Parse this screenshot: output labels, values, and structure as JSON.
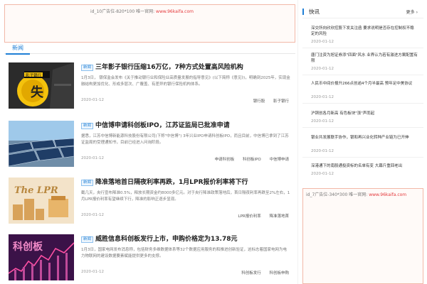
{
  "ads": {
    "top": {
      "label": "id_10广告位-820*100 唯一官网:",
      "url": "www.96kaifa.com"
    },
    "side": {
      "label": "id_7广告位-340*300 唯一官网:",
      "url": "www.96kaifa.com"
    }
  },
  "tabs": [
    {
      "label": "新闻"
    }
  ],
  "news": [
    {
      "tag": "新闻",
      "title": "三年影子银行压缩16万亿，7种方式处置高风险机构",
      "desc": "1月3日， 银保监会发布《关于推动银行业和保险业高质量发展的指导意见》(以下简称《意见》)，明确到2025年，实现金融结构更加优化、形成多层次、广覆盖、有差异的银行保险机构体系。",
      "date": "2020-01-12",
      "tags": [
        "银行股",
        "影子银行"
      ],
      "thumb_caption": "影子银行",
      "thumb_char": "失"
    },
    {
      "tag": "新闻",
      "title": "中信博申请科创板IPO，江苏证监局已批准申请",
      "desc": "据悉，江苏中信博新能源科技股份有限公司(下称\"中信博\") 3年兴业IPO申请科创板IPO，而且目前，中信博已拿到了江苏证监局的受理通知书，目前已经进入问询阶段。",
      "date": "2020-01-12",
      "tags": [
        "申请科创板",
        "科创板IPO",
        "中信博申请"
      ]
    },
    {
      "tag": "新闻",
      "title": "降准落地首日隔夜利率再跌，1月LPR报价利率将下行",
      "desc": "截几天，央行宣布降准0.5%，释放长期资金约8000多亿元。对于央行降准政策落地后，首日隔夜利率再跌至2%左右，1月LPR报价利率有望继续下行，降准的影响正逐步显现。",
      "date": "2020-01-12",
      "tags": [
        "LPR报价利率",
        "降准落地首"
      ],
      "thumb_caption": "The LPR"
    },
    {
      "tag": "新闻",
      "title": "威胜信息科创板发行上市，申购价格定为13.78元",
      "desc": "1月3日，国家电网发布消息称，包括财务多维数据体系等32个数据应用服务的和推进创新验证，这标志着国家电网为电力物联网的建设数据要素赋能提供更多的支撑。",
      "date": "2020-01-12",
      "tags": [
        "科创板发行",
        "科创板申购"
      ],
      "thumb_caption": "科创板"
    }
  ],
  "side": {
    "title": "快讯",
    "more": "更多",
    "items": [
      {
        "text": "深交所向欣欣控股下发关注函 要求说明是否存在控制权不稳定的风险",
        "date": "2020-01-12"
      },
      {
        "text": "唐门注资为旭证券添\"四面\"风水 业界认为若有激进方案配置有限",
        "date": "2020-01-12"
      },
      {
        "text": "人民币中间价报升266点创逾4个月半最高 预年足中美协议",
        "date": "2020-01-12"
      },
      {
        "text": "沪铜创各月新高 有色板块\"涨\"声而起",
        "date": "2020-01-12"
      },
      {
        "text": "银业共发展联手协作，银和再兴业化转种产业链为已开伸",
        "date": "2020-01-12"
      },
      {
        "text": "深港通下的南股通投资标的名单有变 大幕斤重回老出",
        "date": "2020-01-12"
      }
    ]
  },
  "colors": {
    "accent": "#1f7fd6",
    "ad_border": "#f2b8a8",
    "ad_url": "#e4393c"
  }
}
